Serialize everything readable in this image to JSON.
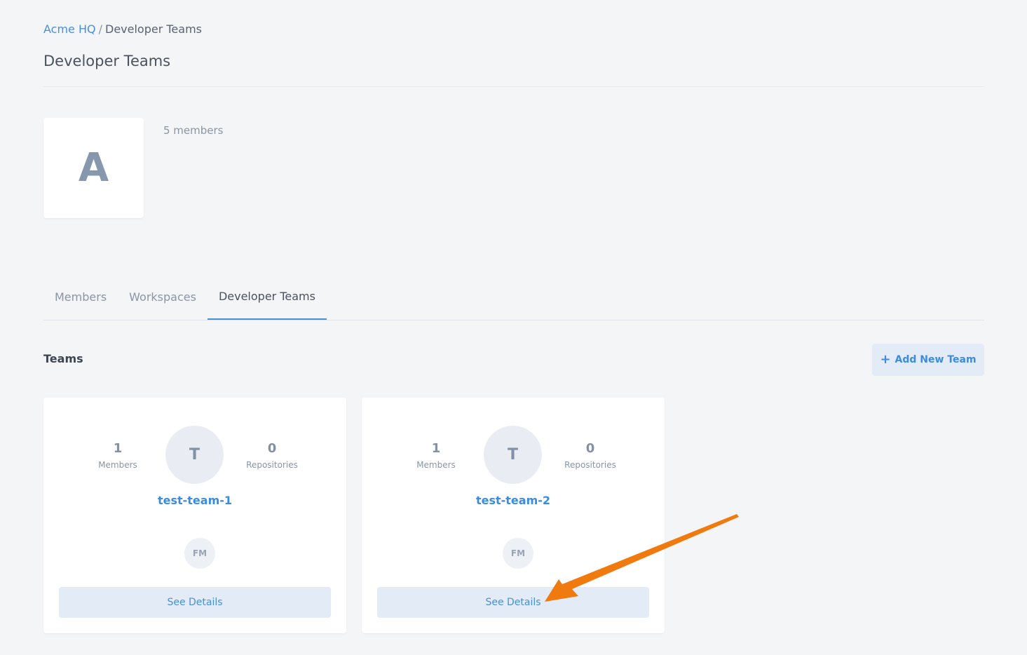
{
  "breadcrumb": {
    "parent": "Acme HQ",
    "separator": "/",
    "current": "Developer Teams"
  },
  "page": {
    "title": "Developer Teams"
  },
  "organization": {
    "avatar_letter": "A",
    "members_text": "5 members"
  },
  "tabs": [
    {
      "label": "Members",
      "active": false
    },
    {
      "label": "Workspaces",
      "active": false
    },
    {
      "label": "Developer Teams",
      "active": true
    }
  ],
  "teams_section": {
    "title": "Teams",
    "add_button_label": "Add New Team",
    "add_button_icon": "plus-icon"
  },
  "teams": [
    {
      "name": "test-team-1",
      "avatar_letter": "T",
      "members_count": "1",
      "members_label": "Members",
      "repositories_count": "0",
      "repositories_label": "Repositories",
      "member_initials": [
        "FM"
      ],
      "details_label": "See Details"
    },
    {
      "name": "test-team-2",
      "avatar_letter": "T",
      "members_count": "1",
      "members_label": "Members",
      "repositories_count": "0",
      "repositories_label": "Repositories",
      "member_initials": [
        "FM"
      ],
      "details_label": "See Details"
    }
  ],
  "annotation": {
    "arrow_color": "#f07a0e"
  },
  "colors": {
    "accent": "#4a90d9",
    "background": "#f4f5f7",
    "button_bg": "#e2ebf6"
  }
}
